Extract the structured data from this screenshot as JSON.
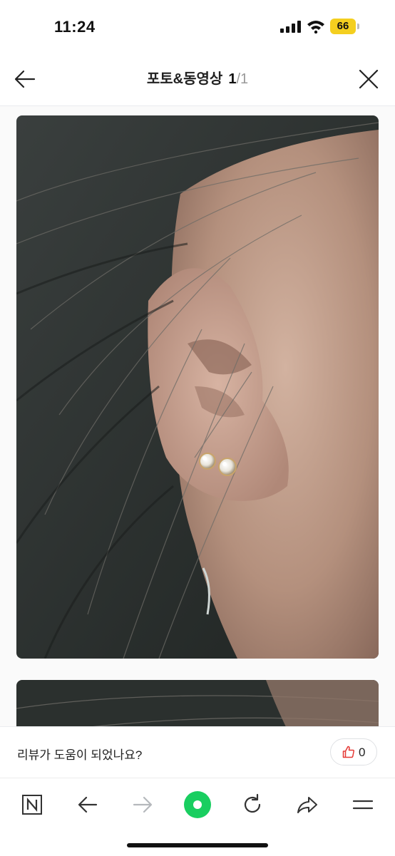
{
  "status_bar": {
    "time": "11:24",
    "battery": "66",
    "battery_color": "#f4cf1f"
  },
  "header": {
    "back_icon": "arrow-left-icon",
    "title": "포토&동영상",
    "page_current": "1",
    "page_separator": "/",
    "page_total": "1",
    "close_icon": "close-x-icon"
  },
  "gallery": {
    "images": [
      {
        "alt": "diamond stud earring on ear"
      },
      {
        "alt": "second review photo (partially visible)"
      }
    ]
  },
  "feedback": {
    "question": "리뷰가 도움이 되었나요?",
    "like_icon": "thumbs-up-icon",
    "like_count": "0",
    "like_color": "#e53935"
  },
  "toolbar": {
    "items": [
      {
        "icon": "naver-n-icon"
      },
      {
        "icon": "back-arrow-icon"
      },
      {
        "icon": "forward-arrow-icon",
        "disabled": true
      },
      {
        "icon": "green-dot-icon"
      },
      {
        "icon": "reload-icon"
      },
      {
        "icon": "share-icon"
      },
      {
        "icon": "menu-icon"
      }
    ],
    "green_color": "#19ce60"
  }
}
